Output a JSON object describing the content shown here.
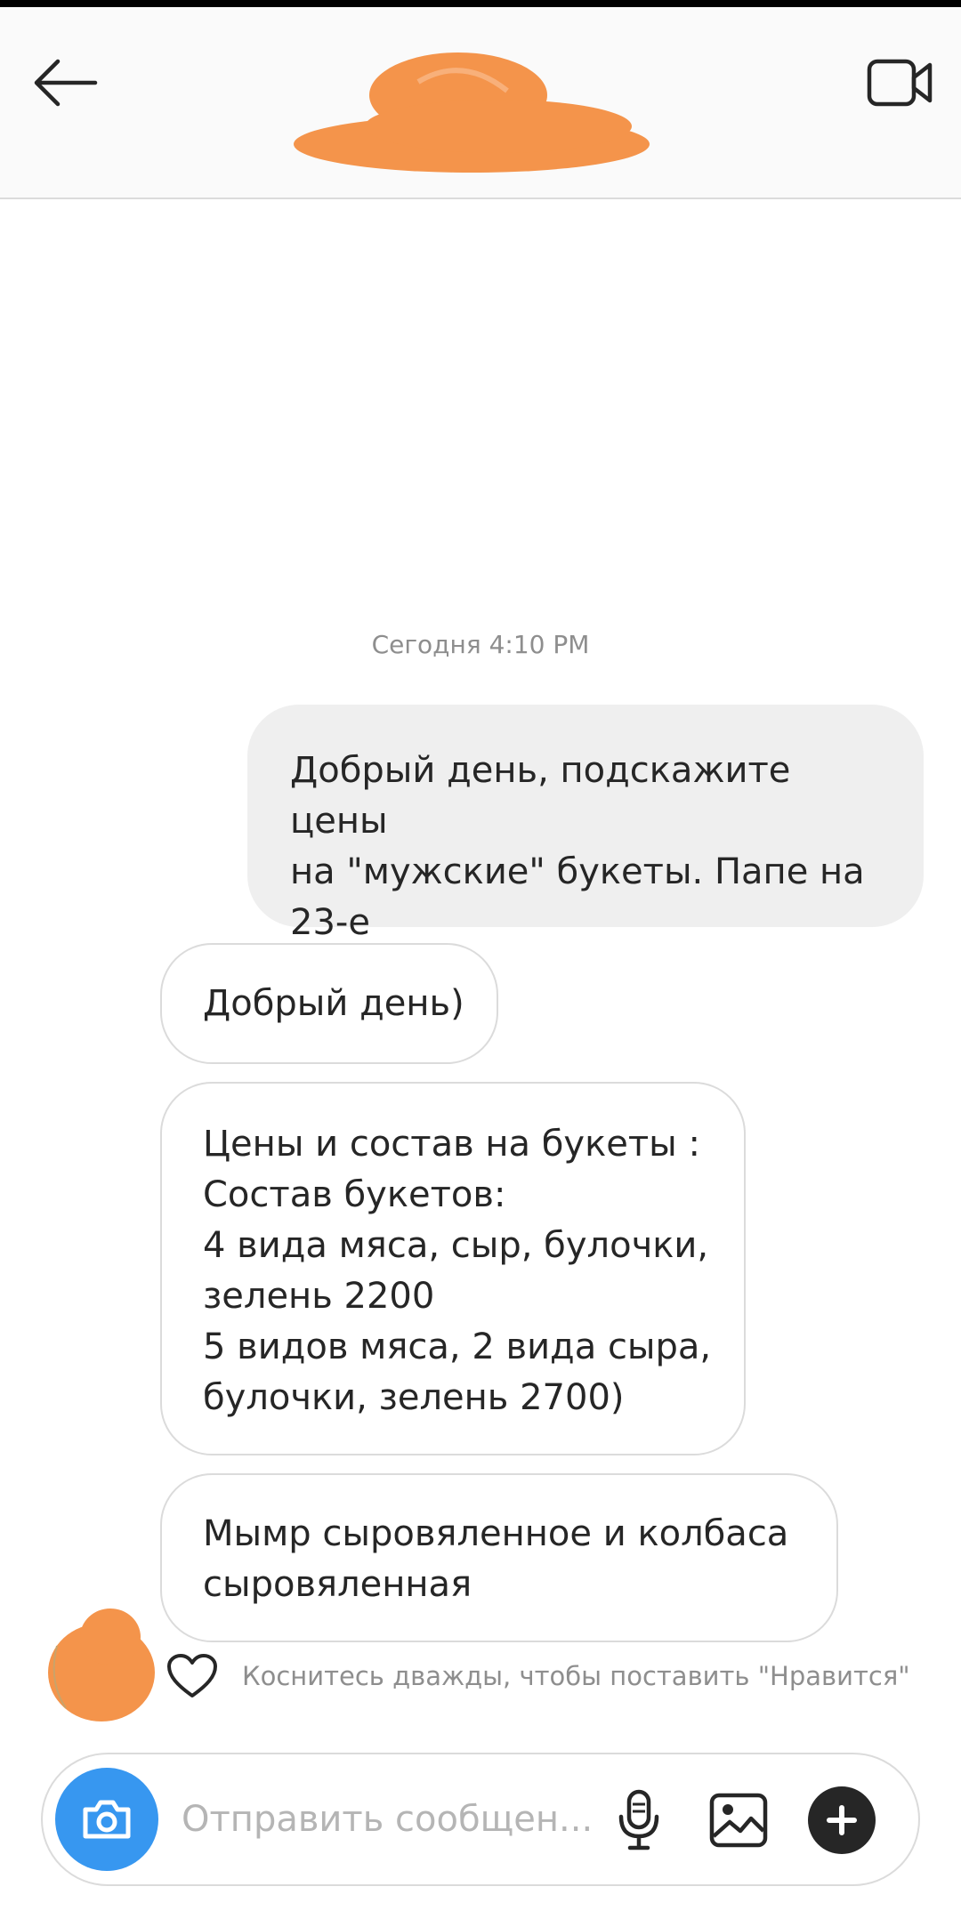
{
  "header": {
    "back_icon": "arrow-left-icon",
    "video_icon": "video-camera-icon",
    "accent_color": "#f4944b"
  },
  "conversation": {
    "timestamp": "Сегодня 4:10 PM",
    "messages": [
      {
        "direction": "outgoing",
        "text": "Добрый день, подскажите цены\nна \"мужские\" букеты. Папе на\n23-е"
      },
      {
        "direction": "incoming",
        "text": "Добрый день)"
      },
      {
        "direction": "incoming",
        "text": "Цены и состав на букеты :\nСостав букетов:\n4 вида мяса, сыр, булочки,\nзелень 2200\n5 видов мяса, 2 вида сыра,\nбулочки, зелень 2700)"
      },
      {
        "direction": "incoming",
        "text": "Мымр сыровяленное и колбаса\nсыровяленная"
      }
    ],
    "like_hint": "Коснитесь дважды, чтобы поставить \"Нравится\""
  },
  "composer": {
    "placeholder": "Отправить сообщен...",
    "camera_color": "#3797f0",
    "icons": [
      "camera-icon",
      "microphone-icon",
      "gallery-icon",
      "plus-icon"
    ]
  }
}
